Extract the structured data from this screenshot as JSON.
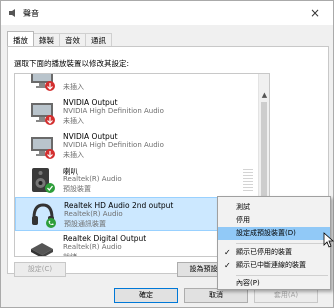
{
  "window": {
    "title": "聲音",
    "close": "×"
  },
  "tabs": [
    {
      "label": "播放"
    },
    {
      "label": "錄製"
    },
    {
      "label": "音效"
    },
    {
      "label": "通訊"
    }
  ],
  "instruction": "選取下面的播放裝置以修改其設定:",
  "devices": [
    {
      "icon": "monitor-icon",
      "name": "",
      "desc": "",
      "status": "未插入",
      "badge": "unplugged",
      "selected": false
    },
    {
      "icon": "monitor-icon",
      "name": "NVIDIA Output",
      "desc": "NVIDIA High Definition Audio",
      "status": "未插入",
      "badge": "unplugged",
      "selected": false
    },
    {
      "icon": "monitor-icon",
      "name": "NVIDIA Output",
      "desc": "NVIDIA High Definition Audio",
      "status": "未插入",
      "badge": "unplugged",
      "selected": false
    },
    {
      "icon": "speaker-icon",
      "name": "喇叭",
      "desc": "Realtek(R) Audio",
      "status": "預設裝置",
      "badge": "default",
      "selected": false
    },
    {
      "icon": "headphones-icon",
      "name": "Realtek HD Audio 2nd output",
      "desc": "Realtek(R) Audio",
      "status": "預設通訊裝置",
      "badge": "comm",
      "selected": true
    },
    {
      "icon": "digital-output-icon",
      "name": "Realtek Digital Output",
      "desc": "Realtek(R) Audio",
      "status": "就緒",
      "badge": "none",
      "selected": false
    }
  ],
  "buttons": {
    "configure": "設定(C)",
    "set_default": "設為預設值(S)",
    "dropdown": "▼",
    "ok": "確定",
    "cancel": "取消",
    "apply": "套用(A)"
  },
  "context_menu": {
    "items": [
      {
        "label": "測試",
        "checked": false,
        "hover": false
      },
      {
        "label": "停用",
        "checked": false,
        "hover": false
      },
      {
        "label": "設定成預設裝置(D)",
        "checked": false,
        "hover": true
      },
      {
        "label": "顯示已停用的裝置",
        "checked": true,
        "hover": false
      },
      {
        "label": "顯示已中斷連線的裝置",
        "checked": true,
        "hover": false
      },
      {
        "label": "內容(P)",
        "checked": false,
        "hover": false
      }
    ],
    "check_mark": "✓"
  },
  "scroll_up": "▲",
  "colors": {
    "accent": "#0078d7",
    "selection": "#cce8ff",
    "menu_hover": "#91c9f7",
    "unplugged_badge": "#d32f2f",
    "ok_badge": "#2e9e3a"
  }
}
